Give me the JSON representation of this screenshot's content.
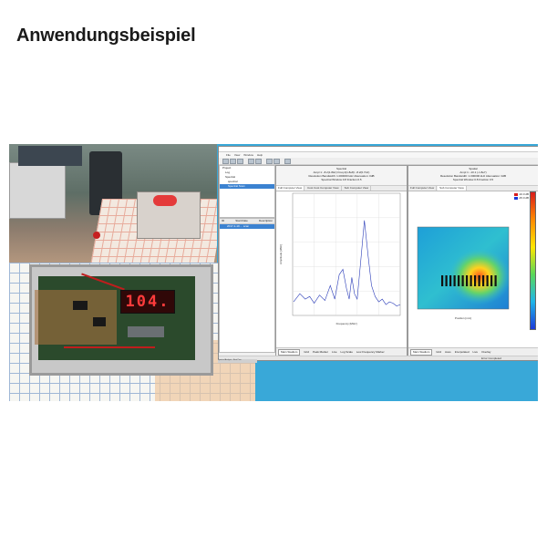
{
  "page": {
    "title": "Anwendungsbeispiel"
  },
  "photo": {
    "display_value": "104."
  },
  "window": {
    "menu": [
      "File",
      "View",
      "Window",
      "Help"
    ],
    "tree": [
      "Project",
      "Log",
      "Spectral",
      "spectral",
      "Spectral Scan"
    ],
    "list": {
      "columns": [
        "ID",
        "Start Date",
        "Description"
      ],
      "row": "2017-1-19 ... scan"
    },
    "spectral": {
      "heading": "Spectral",
      "info_1": "Ampl 1: -8.2(1.8Hz)  Freq 2(1.8e8): -8.2(0.7Hz)",
      "info_2": "Resolution Bandwidth: 1.000000 kHz   Attenuation: 0dB",
      "info_3": "Spectral Window 0.8 Fraction 0.5",
      "tabs": [
        "Full Computer View",
        "Cost Cost Computer View",
        "Sub Computer View"
      ],
      "ylabel": "Amplitude [dBm]",
      "xlabel": "Frequency [MHz]",
      "foot": {
        "view_select": "Main Stadium",
        "options": [
          "Grid",
          "Peak Marker",
          "Live",
          "Log Scale",
          "Low Frequency Marker"
        ]
      }
    },
    "spatial": {
      "heading": "Spatial",
      "info_1": "Ampl 1: -10.1 (-1.8e7)",
      "info_2": "Resolution Bandwidth: 1.000000 kHz   Attenuation: 0dB",
      "info_3": "Spectral Window 0.8 Fraction 0.5",
      "tabs": [
        "Full Computer View",
        "Sub Computer View"
      ],
      "xlabel": "Position [mm]",
      "legend": [
        "-10.0 dB",
        "-45.0 dB"
      ],
      "foot": {
        "view_select": "Main Stadium",
        "options": [
          "Grid",
          "Axes",
          "Interpolated",
          "Live",
          "Overlay"
        ]
      }
    },
    "status": "Error      Completed"
  },
  "taskbar": {
    "label": "Spectral Analysis - Best Prev"
  },
  "chart_data": [
    {
      "type": "line",
      "title": "Spectral",
      "xlabel": "Frequency [MHz]",
      "ylabel": "Amplitude [dBm]",
      "series": [
        {
          "x": [
            1,
            8,
            14,
            19,
            24,
            30,
            36,
            42,
            47,
            52,
            56,
            60,
            63,
            66,
            69,
            72,
            76,
            80,
            84,
            88,
            92,
            96,
            100,
            104,
            108,
            112,
            116,
            120
          ],
          "y": [
            -90,
            -84,
            -88,
            -86,
            -91,
            -85,
            -89,
            -78,
            -88,
            -70,
            -66,
            -80,
            -88,
            -72,
            -84,
            -88,
            -60,
            -30,
            -55,
            -78,
            -86,
            -90,
            -88,
            -92,
            -90,
            -91,
            -93,
            -92
          ]
        }
      ],
      "ylim": [
        -100,
        -10
      ],
      "grid": true
    }
  ]
}
